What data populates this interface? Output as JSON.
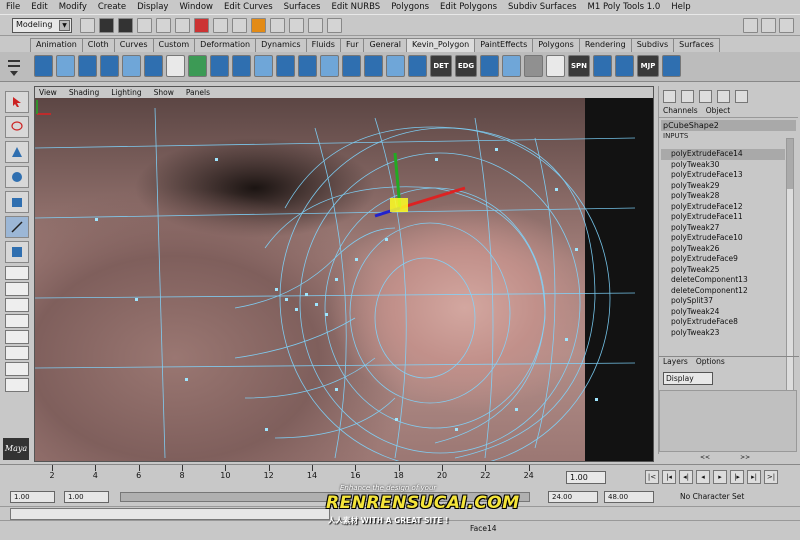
{
  "menubar": [
    "File",
    "Edit",
    "Modify",
    "Create",
    "Display",
    "Window",
    "Edit Curves",
    "Surfaces",
    "Edit NURBS",
    "Polygons",
    "Edit Polygons",
    "Subdiv Surfaces",
    "M1 Poly Tools 1.0",
    "Help"
  ],
  "statusline": {
    "mode": "Modeling"
  },
  "shelf": {
    "tabs": [
      "Animation",
      "Cloth",
      "Curves",
      "Custom",
      "Deformation",
      "Dynamics",
      "Fluids",
      "Fur",
      "General",
      "Kevin_Polygon",
      "PaintEffects",
      "Polygons",
      "Rendering",
      "Subdivs",
      "Surfaces"
    ],
    "active_tab": "Kevin_Polygon",
    "text_icons": [
      "DET",
      "EDG",
      "SPN",
      "MJP"
    ]
  },
  "viewport": {
    "menu": [
      "View",
      "Shading",
      "Lighting",
      "Show",
      "Panels"
    ]
  },
  "channelbox": {
    "tabs": [
      "Channels",
      "Object"
    ],
    "shape_name": "pCubeShape2",
    "inputs_label": "INPUTS",
    "items": [
      "polyExtrudeFace14",
      "polyTweak30",
      "polyExtrudeFace13",
      "polyTweak29",
      "polyTweak28",
      "polyExtrudeFace12",
      "polyExtrudeFace11",
      "polyTweak27",
      "polyExtrudeFace10",
      "polyTweak26",
      "polyExtrudeFace9",
      "polyTweak25",
      "deleteComponent13",
      "deleteComponent12",
      "polySplit37",
      "polyTweak24",
      "polyExtrudeFace8",
      "polyTweak23"
    ],
    "selected_index": 0,
    "layers_tabs": [
      "Layers",
      "Options"
    ],
    "layer_display": "Display",
    "lower_bar": [
      "<<",
      ">>"
    ]
  },
  "timeline": {
    "ticks": [
      "2",
      "4",
      "6",
      "8",
      "10",
      "12",
      "14",
      "16",
      "18",
      "20",
      "22",
      "24"
    ],
    "current_frame": "1.00",
    "playback_buttons": [
      "|<",
      "|◂",
      "◂|",
      "◂",
      "▸",
      "|▸",
      "▸|",
      ">|"
    ]
  },
  "range": {
    "start": "1.00",
    "start_inner": "1.00",
    "end_inner": "24.00",
    "end": "48.00",
    "character_set": "No Character Set"
  },
  "helpline": {
    "text": "Face14"
  },
  "watermark": {
    "top": "Enhance the design of your",
    "brand": "RENRENSUCAI.COM",
    "bottom": "人人素材  WITH A GREAT SITE !"
  },
  "colors": {
    "accent_selection": "#a9a9a9",
    "wireframe": "#7fd6ff",
    "brand_yellow": "#f4e43a"
  }
}
